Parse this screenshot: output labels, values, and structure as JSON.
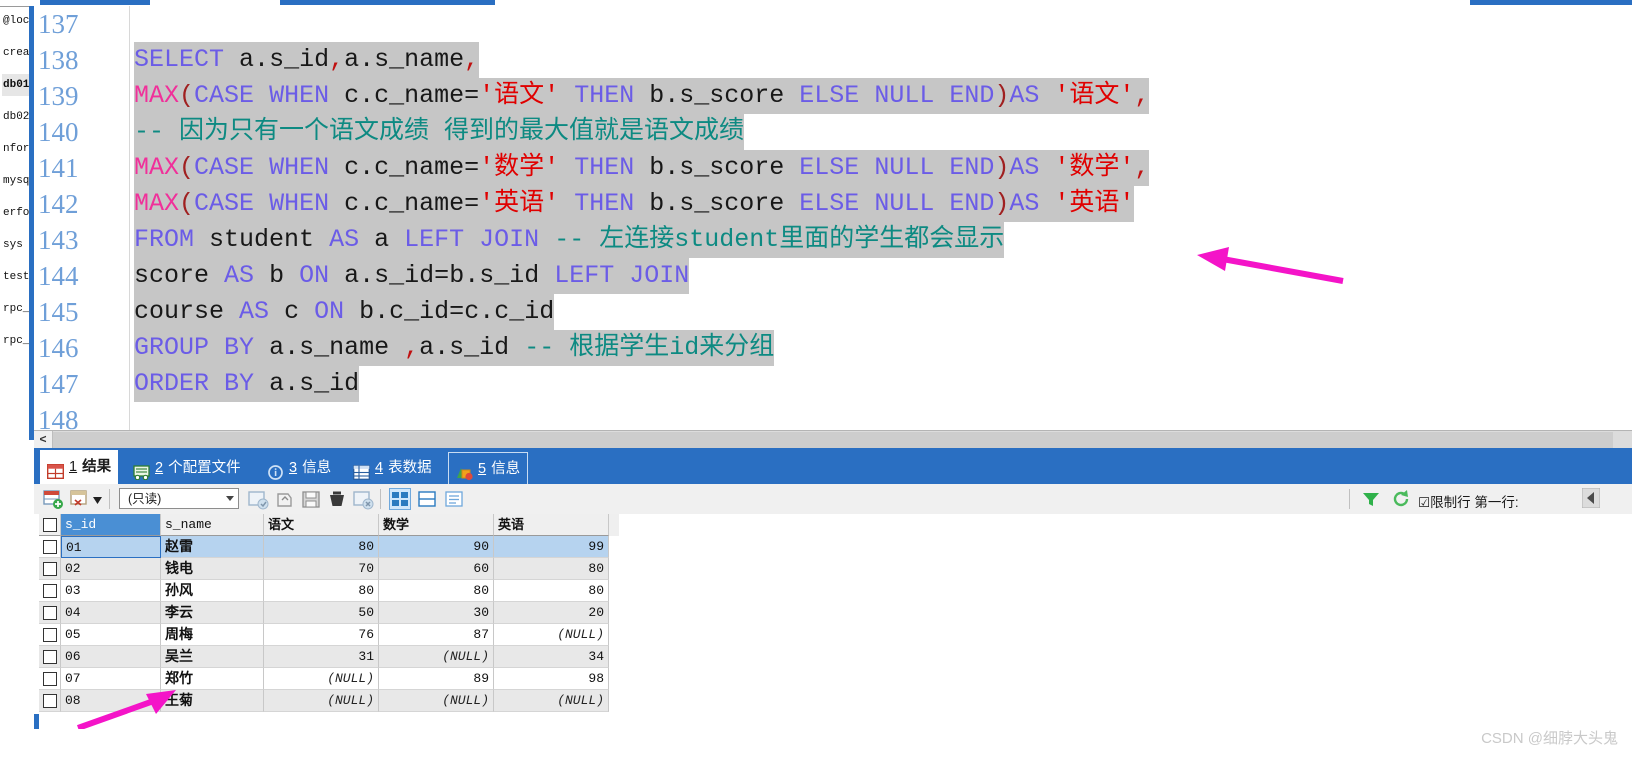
{
  "sidebar": {
    "items": [
      {
        "label": "@loc",
        "selected": false
      },
      {
        "label": "creat",
        "selected": false
      },
      {
        "label": "db01",
        "selected": true
      },
      {
        "label": "db02",
        "selected": false
      },
      {
        "label": "nfor",
        "selected": false
      },
      {
        "label": "mysql",
        "selected": false
      },
      {
        "label": "erfo",
        "selected": false
      },
      {
        "label": "sys",
        "selected": false
      },
      {
        "label": "testd",
        "selected": false
      },
      {
        "label": "rpc_d",
        "selected": false
      },
      {
        "label": "rpc_d",
        "selected": false
      }
    ]
  },
  "editor": {
    "line_numbers": [
      "137",
      "138",
      "139",
      "140",
      "141",
      "142",
      "143",
      "144",
      "145",
      "146",
      "147",
      "148"
    ],
    "lines": [
      {
        "no": "137",
        "text": "",
        "selected": false
      },
      {
        "no": "138",
        "text": "SELECT a.s_id,a.s_name,",
        "selected": true
      },
      {
        "no": "139",
        "text": "MAX(CASE WHEN c.c_name='语文' THEN b.s_score ELSE NULL END)AS '语文',",
        "selected": true
      },
      {
        "no": "140",
        "text": "-- 因为只有一个语文成绩 得到的最大值就是语文成绩",
        "selected": true
      },
      {
        "no": "141",
        "text": "MAX(CASE WHEN c.c_name='数学' THEN b.s_score ELSE NULL END)AS '数学',",
        "selected": true
      },
      {
        "no": "142",
        "text": "MAX(CASE WHEN c.c_name='英语' THEN b.s_score ELSE NULL END)AS '英语'",
        "selected": true
      },
      {
        "no": "143",
        "text": "FROM student AS a LEFT JOIN -- 左连接student里面的学生都会显示",
        "selected": true
      },
      {
        "no": "144",
        "text": "score AS b ON a.s_id=b.s_id LEFT JOIN",
        "selected": true
      },
      {
        "no": "145",
        "text": "course AS c ON b.c_id=c.c_id",
        "selected": true
      },
      {
        "no": "146",
        "text": "GROUP BY a.s_name ,a.s_id -- 根据学生id来分组",
        "selected": true
      },
      {
        "no": "147",
        "text": "ORDER BY a.s_id",
        "selected": true
      },
      {
        "no": "148",
        "text": "",
        "selected": false
      }
    ],
    "colors": {
      "keyword": "#6b5ce7",
      "function": "#f0309a",
      "string": "#e00000",
      "comment": "#0d8a82",
      "identifier": "#181818",
      "linenumber": "#6f9fd8",
      "selection": "#c6c6c6"
    }
  },
  "scrollbar": {
    "left_arrow": "<"
  },
  "tabs": [
    {
      "num": "1",
      "label": "结果",
      "icon": "grid-icon",
      "active": true,
      "boxed": false
    },
    {
      "num": "2",
      "label": "个配置文件",
      "icon": "profile-icon",
      "active": false,
      "boxed": false
    },
    {
      "num": "3",
      "label": "信息",
      "icon": "info-icon",
      "active": false,
      "boxed": false
    },
    {
      "num": "4",
      "label": "表数据",
      "icon": "table-icon",
      "active": false,
      "boxed": false
    },
    {
      "num": "5",
      "label": "信息",
      "icon": "status-icon",
      "active": false,
      "boxed": true
    }
  ],
  "gridbar": {
    "readonly_value": "(只读)",
    "limit_label": "☑限制行  第一行:",
    "buttons": [
      "add-record-icon",
      "delete-record-icon",
      "apply-changes-icon",
      "discard-changes-icon",
      "save-icon",
      "delete-icon",
      "cancel-icon",
      "grid-view-icon",
      "form-view-icon",
      "detail-view-icon",
      "filter-icon",
      "refresh-icon"
    ]
  },
  "grid": {
    "columns": [
      "s_id",
      "s_name",
      "语文",
      "数学",
      "英语"
    ],
    "rows": [
      {
        "s_id": "01",
        "s_name": "赵雷",
        "yuwen": "80",
        "shuxue": "90",
        "yingyu": "99",
        "selected": true
      },
      {
        "s_id": "02",
        "s_name": "钱电",
        "yuwen": "70",
        "shuxue": "60",
        "yingyu": "80",
        "selected": false
      },
      {
        "s_id": "03",
        "s_name": "孙风",
        "yuwen": "80",
        "shuxue": "80",
        "yingyu": "80",
        "selected": false
      },
      {
        "s_id": "04",
        "s_name": "李云",
        "yuwen": "50",
        "shuxue": "30",
        "yingyu": "20",
        "selected": false
      },
      {
        "s_id": "05",
        "s_name": "周梅",
        "yuwen": "76",
        "shuxue": "87",
        "yingyu": "(NULL)",
        "selected": false
      },
      {
        "s_id": "06",
        "s_name": "吴兰",
        "yuwen": "31",
        "shuxue": "(NULL)",
        "yingyu": "34",
        "selected": false
      },
      {
        "s_id": "07",
        "s_name": "郑竹",
        "yuwen": "(NULL)",
        "shuxue": "89",
        "yingyu": "98",
        "selected": false
      },
      {
        "s_id": "08",
        "s_name": "王菊",
        "yuwen": "(NULL)",
        "shuxue": "(NULL)",
        "yingyu": "(NULL)",
        "selected": false
      }
    ]
  },
  "annotations": {
    "arrow_color": "#f414c8",
    "arrow_editor_name": "editor-pointer-arrow",
    "arrow_grid_name": "grid-pointer-arrow"
  },
  "watermark": {
    "text": "CSDN @细脖大头鬼"
  }
}
